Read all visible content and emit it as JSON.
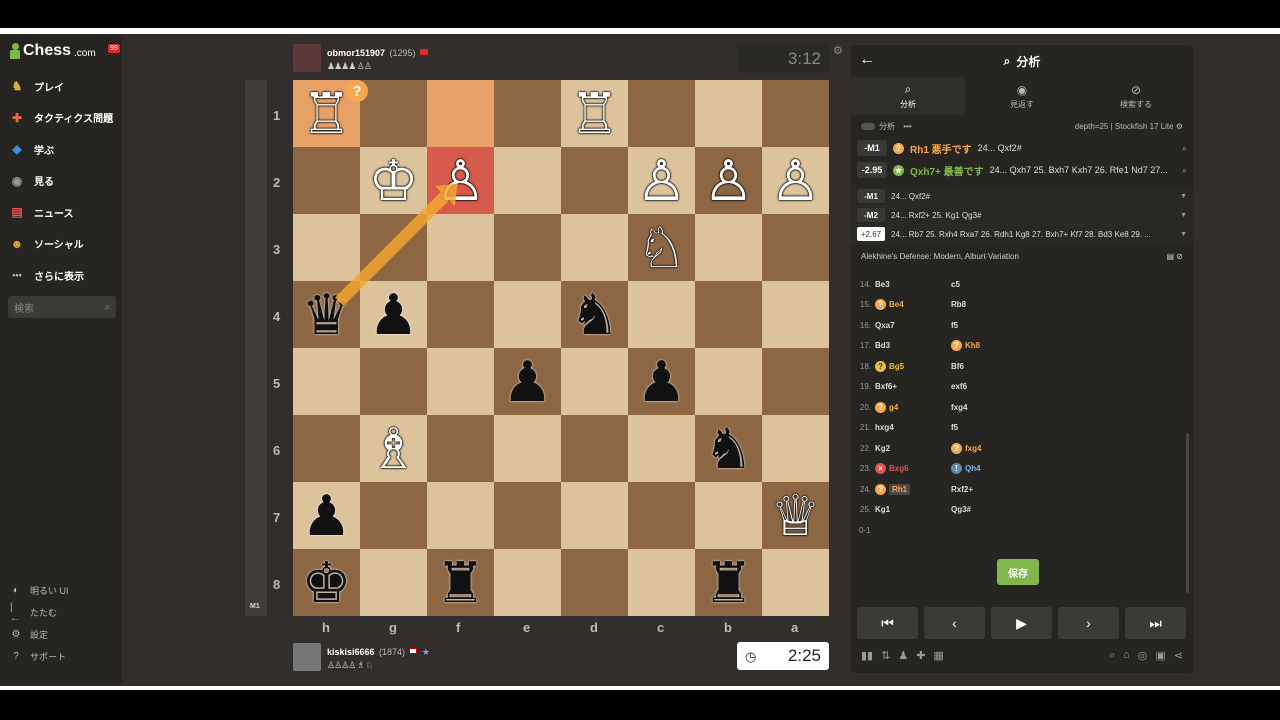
{
  "sidebar": {
    "logo": "Chess",
    "logo_suffix": ".com",
    "notification_count": "99",
    "items": [
      {
        "label": "プレイ",
        "icon": "play-icon",
        "color": "#e8a840"
      },
      {
        "label": "タクティクス問題",
        "icon": "puzzle-icon",
        "color": "#e8703c"
      },
      {
        "label": "学ぶ",
        "icon": "learn-icon",
        "color": "#3c8ce8"
      },
      {
        "label": "見る",
        "icon": "watch-icon",
        "color": "#999999"
      },
      {
        "label": "ニュース",
        "icon": "news-icon",
        "color": "#e85050"
      },
      {
        "label": "ソーシャル",
        "icon": "social-icon",
        "color": "#e8a840"
      },
      {
        "label": "さらに表示",
        "icon": "more-icon",
        "color": "#bbbbbb"
      }
    ],
    "search_placeholder": "検索",
    "bottom": [
      {
        "label": "明るい UI",
        "icon": "theme-icon"
      },
      {
        "label": "たたむ",
        "icon": "collapse-icon"
      },
      {
        "label": "設定",
        "icon": "settings-icon"
      },
      {
        "label": "サポート",
        "icon": "support-icon"
      }
    ]
  },
  "eval_label": "M1",
  "top_player": {
    "name": "obmor151907",
    "rating": "(1295)",
    "captured": "♟♟♟♟ ♙♙",
    "clock": "3:12"
  },
  "bottom_player": {
    "name": "kiskisi6666",
    "rating": "(1874)",
    "captured": "♙♙♙♙ ♗ ♘",
    "clock": "2:25"
  },
  "board": {
    "orientation": "black",
    "ranks": [
      "1",
      "2",
      "3",
      "4",
      "5",
      "6",
      "7",
      "8"
    ],
    "files": [
      "h",
      "g",
      "f",
      "e",
      "d",
      "c",
      "b",
      "a"
    ],
    "highlight_squares": [
      "h1",
      "f1"
    ],
    "red_square": "f2",
    "arrow": {
      "from": "h4",
      "to": "f2",
      "color": "#f3a633"
    },
    "badge": {
      "square": "h1",
      "symbol": "?"
    },
    "pieces": [
      {
        "sq": "h1",
        "p": "wR"
      },
      {
        "sq": "d1",
        "p": "wR"
      },
      {
        "sq": "g2",
        "p": "wK"
      },
      {
        "sq": "f2",
        "p": "wP"
      },
      {
        "sq": "c2",
        "p": "wP"
      },
      {
        "sq": "b2",
        "p": "wP"
      },
      {
        "sq": "a2",
        "p": "wP"
      },
      {
        "sq": "c3",
        "p": "wN"
      },
      {
        "sq": "h4",
        "p": "bQ"
      },
      {
        "sq": "g4",
        "p": "bP"
      },
      {
        "sq": "d4",
        "p": "bN"
      },
      {
        "sq": "e5",
        "p": "bP"
      },
      {
        "sq": "c5",
        "p": "bP"
      },
      {
        "sq": "g6",
        "p": "wB"
      },
      {
        "sq": "b6",
        "p": "bN"
      },
      {
        "sq": "h7",
        "p": "bP"
      },
      {
        "sq": "a7",
        "p": "wQ"
      },
      {
        "sq": "h8",
        "p": "bK"
      },
      {
        "sq": "f8",
        "p": "bR"
      },
      {
        "sq": "b8",
        "p": "bR"
      }
    ]
  },
  "panel": {
    "title": "分析",
    "tabs": [
      {
        "label": "分析",
        "icon": "analysis-icon"
      },
      {
        "label": "見返す",
        "icon": "review-icon"
      },
      {
        "label": "検索する",
        "icon": "explore-icon"
      }
    ],
    "sub_label": "分析",
    "engine": "depth=25 | Stockfish 17 Lite",
    "eval_rows": [
      {
        "eval": "-M1",
        "mark": "?",
        "move": "Rh1 悪手です",
        "line": "24... Qxf2#",
        "cls": "orange",
        "mcls": "q"
      },
      {
        "eval": "-2.95",
        "mark": "★",
        "move": "Qxh7+ 最善です",
        "line": "24... Qxh7 25. Bxh7 Kxh7 26. Rfe1 Nd7 27...",
        "cls": "green",
        "mcls": "g"
      }
    ],
    "lines": [
      {
        "eval": "-M1",
        "text": "24... Qxf2#",
        "white": false
      },
      {
        "eval": "-M2",
        "text": "24... Rxf2+ 25. Kg1 Qg3#",
        "white": false
      },
      {
        "eval": "+2.67",
        "text": "24... Rb7 25. Rxh4 Rxa7 26. Rdh1 Kg8 27. Bxh7+ Kf7 28. Bd3 Ke8 29. ...",
        "white": true
      }
    ],
    "opening": "Alekhine's Defense: Modern, Alburt Variation",
    "moves": [
      {
        "n": "14.",
        "w": "Be3",
        "wm": "",
        "wc": "",
        "b": "c5",
        "bm": "",
        "bc": ""
      },
      {
        "n": "15.",
        "w": "Be4",
        "wm": "?",
        "wc": "orange",
        "b": "Rb8",
        "bm": "",
        "bc": ""
      },
      {
        "n": "16.",
        "w": "Qxa7",
        "wm": "",
        "wc": "",
        "b": "f5",
        "bm": "",
        "bc": ""
      },
      {
        "n": "17.",
        "w": "Bd3",
        "wm": "",
        "wc": "",
        "b": "Kh8",
        "bm": "?",
        "bc": "orange"
      },
      {
        "n": "18.",
        "w": "Bg5",
        "wm": "?",
        "wc": "yellow",
        "b": "Bf6",
        "bm": "",
        "bc": ""
      },
      {
        "n": "19.",
        "w": "Bxf6+",
        "wm": "",
        "wc": "",
        "b": "exf6",
        "bm": "",
        "bc": ""
      },
      {
        "n": "20.",
        "w": "g4",
        "wm": "?",
        "wc": "orange",
        "b": "fxg4",
        "bm": "",
        "bc": ""
      },
      {
        "n": "21.",
        "w": "hxg4",
        "wm": "",
        "wc": "",
        "b": "f5",
        "bm": "",
        "bc": ""
      },
      {
        "n": "22.",
        "w": "Kg2",
        "wm": "",
        "wc": "",
        "b": "fxg4",
        "bm": "?",
        "bc": "orange"
      },
      {
        "n": "23.",
        "w": "Bxg6",
        "wm": "×",
        "wc": "red2",
        "b": "Qh4",
        "bm": "!",
        "bc": "blue"
      },
      {
        "n": "24.",
        "w": "Rh1",
        "wm": "?",
        "wc": "orange",
        "b": "Rxf2+",
        "bm": "",
        "bc": ""
      },
      {
        "n": "25.",
        "w": "Kg1",
        "wm": "",
        "wc": "",
        "b": "Qg3#",
        "bm": "",
        "bc": ""
      }
    ],
    "result": "0-1",
    "save_label": "保存"
  }
}
